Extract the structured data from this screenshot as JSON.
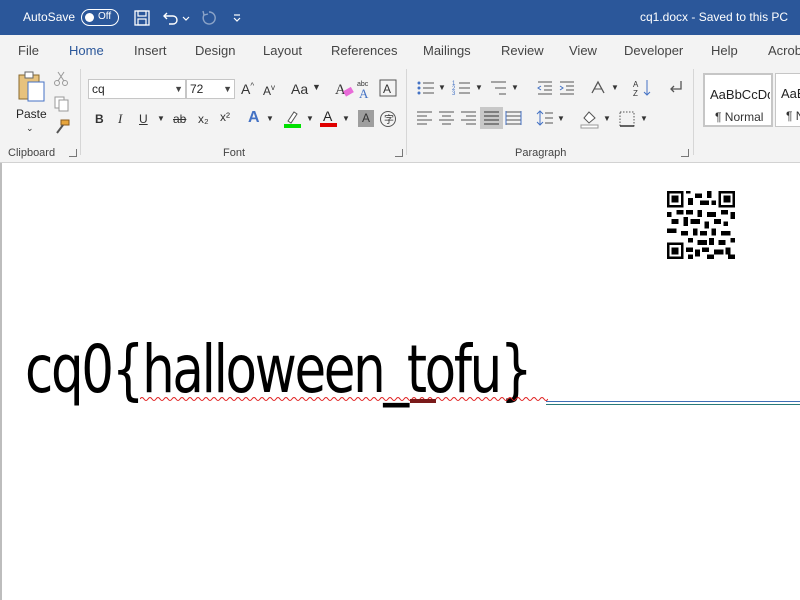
{
  "titlebar": {
    "autosave_label": "AutoSave",
    "autosave_state": "Off",
    "document_title": "cq1.docx  -  Saved to this PC",
    "bg_color": "#2b579a"
  },
  "tabs": [
    {
      "label": "File"
    },
    {
      "label": "Home",
      "active": true
    },
    {
      "label": "Insert"
    },
    {
      "label": "Design"
    },
    {
      "label": "Layout"
    },
    {
      "label": "References"
    },
    {
      "label": "Mailings"
    },
    {
      "label": "Review"
    },
    {
      "label": "View"
    },
    {
      "label": "Developer"
    },
    {
      "label": "Help"
    },
    {
      "label": "Acrob"
    }
  ],
  "ribbon": {
    "clipboard": {
      "paste_label": "Paste",
      "group_label": "Clipboard"
    },
    "font": {
      "font_name": "cq",
      "font_size": "72",
      "change_case": "Aa",
      "bold": "B",
      "italic": "I",
      "underline": "U",
      "strike": "ab",
      "subscript": "x₂",
      "superscript": "x²",
      "text_effects": "A",
      "font_color": "A",
      "grow": "A",
      "shrink": "A",
      "group_label": "Font"
    },
    "paragraph": {
      "group_label": "Paragraph"
    },
    "styles": [
      {
        "sample": "AaBbCcDd",
        "name": "¶ Normal"
      },
      {
        "sample": "AaBbCcDd",
        "name": "¶ No"
      }
    ]
  },
  "document": {
    "text": "cq0{halloween_tofu}"
  }
}
